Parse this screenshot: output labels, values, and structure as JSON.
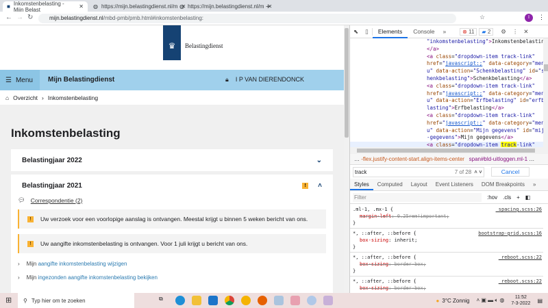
{
  "browser": {
    "tabs": [
      {
        "title": "Inkomstenbelasting - Mijn Belast"
      },
      {
        "title": "https://mijn.belastingdienst.nl/m"
      },
      {
        "title": "https://mijn.belastingdienst.nl/m"
      }
    ],
    "url_host": "mijn.belastingdienst.nl",
    "url_path": "/mbd-pmb/pmb.html#inkomstenbelasting:"
  },
  "site": {
    "logo_text": "Belastingdienst",
    "menu_label": "Menu",
    "title": "Mijn Belastingdienst",
    "user": "I P VAN DIERENDONCK",
    "breadcrumb": [
      "Overzicht",
      "Inkomstenbelasting"
    ],
    "heading": "Inkomstenbelasting",
    "year2022": "Belastingjaar 2022",
    "year2021": "Belastingjaar 2021",
    "warn_mark": "!",
    "correspondence": "Correspondentie (2)",
    "alerts": [
      "Uw verzoek voor een voorlopige aanslag is ontvangen. Meestal krijgt u binnen 5 weken bericht van ons.",
      "Uw aangifte inkomstenbelasting is ontvangen. Voor 1 juli krijgt u bericht van ons."
    ],
    "links": [
      {
        "prefix": "Mijn",
        "link": "aangifte inkomstenbelasting wijzigen"
      },
      {
        "prefix": "Mijn",
        "link": "ingezonden aangifte inkomstenbelasting bekijken"
      }
    ]
  },
  "devtools": {
    "tabs": [
      "Elements",
      "Console"
    ],
    "errors": "11",
    "messages": "2",
    "breadcrumb_1": "-flex.justify-content-start.align-items-center",
    "breadcrumb_2": "span#bld-uitloggen.ml-1",
    "search_value": "track",
    "search_count": "7 of 28",
    "cancel": "Cancel",
    "style_tabs": [
      "Styles",
      "Computed",
      "Layout",
      "Event Listeners",
      "DOM Breakpoints"
    ],
    "filter_placeholder": "Filter",
    "hov": ":hov",
    "cls": ".cls",
    "rules": [
      {
        "selector": ".ml-1, .mx-1 {",
        "source": "_spacing.scss:26",
        "prop": "margin-left",
        "value": "0.25rem!important;",
        "struck": true
      },
      {
        "selector": "*, ::after, ::before {",
        "source": "bootstrap-grid.scss:16",
        "prop": "box-sizing",
        "value": "inherit;",
        "struck": false
      },
      {
        "selector": "*, ::after, ::before {",
        "source": "_reboot.scss:22",
        "prop": "box-sizing",
        "value": "border-box;",
        "struck": true
      },
      {
        "selector": "*, ::after, ::before {",
        "source": "_reboot.scss:22",
        "prop": "box-sizing",
        "value": "border-box;",
        "struck": true
      }
    ]
  },
  "taskbar": {
    "search_placeholder": "Typ hier om te zoeken",
    "weather": "3°C  Zonnig",
    "time": "11:52",
    "date": "7-3-2022"
  }
}
